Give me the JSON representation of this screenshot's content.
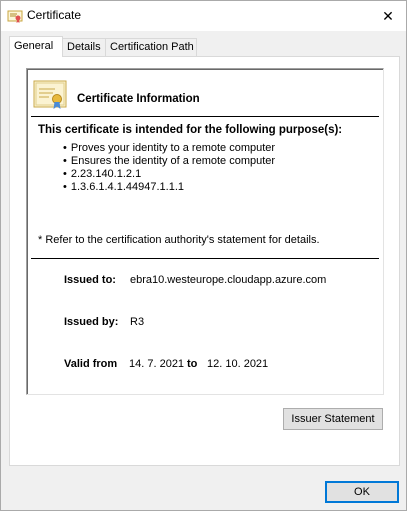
{
  "window": {
    "title": "Certificate",
    "close_glyph": "✕"
  },
  "tabs": [
    {
      "label": "General",
      "active": true
    },
    {
      "label": "Details",
      "active": false
    },
    {
      "label": "Certification Path",
      "active": false
    }
  ],
  "general": {
    "heading": "Certificate Information",
    "purpose_heading": "This certificate is intended for the following purpose(s):",
    "purposes": [
      "Proves your identity to a remote computer",
      "Ensures the identity of a remote computer",
      "2.23.140.1.2.1",
      "1.3.6.1.4.1.44947.1.1.1"
    ],
    "note": "* Refer to the certification authority's statement for details.",
    "issued_to_label": "Issued to:",
    "issued_to_value": "ebra10.westeurope.cloudapp.azure.com",
    "issued_by_label": "Issued by:",
    "issued_by_value": "R3",
    "valid_from_label": "Valid from",
    "valid_from_value": "14. 7. 2021",
    "valid_to_label": "to",
    "valid_to_value": "12. 10. 2021"
  },
  "buttons": {
    "issuer_statement": "Issuer Statement",
    "ok": "OK"
  },
  "colors": {
    "accent": "#0078d7",
    "window_bg": "#f0f0f0"
  }
}
